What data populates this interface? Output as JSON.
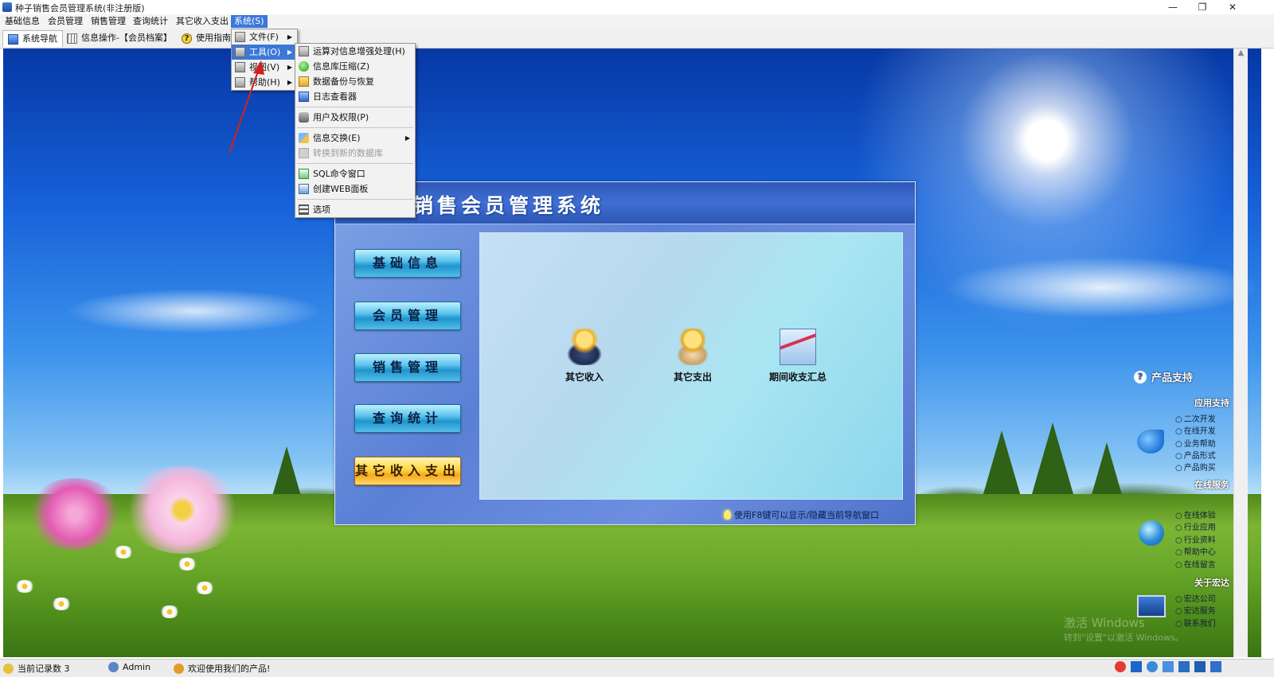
{
  "window": {
    "title": "种子销售会员管理系统(非注册版)",
    "controls": [
      "—",
      "❐",
      "✕"
    ]
  },
  "menubar": [
    {
      "label": "基础信息"
    },
    {
      "label": "会员管理"
    },
    {
      "label": "销售管理"
    },
    {
      "label": "查询统计"
    },
    {
      "label": "其它收入支出"
    },
    {
      "label": "系统(S)"
    }
  ],
  "tabs": [
    {
      "label": "系统导航"
    },
    {
      "label": "信息操作-【会员档案】"
    },
    {
      "label": "使用指南"
    }
  ],
  "system_menu": [
    {
      "label": "文件(F)"
    },
    {
      "label": "工具(O)"
    },
    {
      "label": "视图(V)"
    },
    {
      "label": "帮助(H)"
    }
  ],
  "tools_menu": [
    {
      "label": "运算对信息增强处理(H)"
    },
    {
      "label": "信息库压缩(Z)"
    },
    {
      "label": "数据备份与恢复"
    },
    {
      "label": "日志查看器"
    },
    {
      "label": "用户及权限(P)"
    },
    {
      "label": "信息交换(E)"
    },
    {
      "label": "转换到新的数据库"
    },
    {
      "label": "SQL命令窗口"
    },
    {
      "label": "创建WEB面板"
    },
    {
      "label": "选项"
    }
  ],
  "panel": {
    "title": "销售会员管理系统",
    "nav": [
      {
        "label": "基础信息"
      },
      {
        "label": "会员管理"
      },
      {
        "label": "销售管理"
      },
      {
        "label": "查询统计"
      },
      {
        "label": "其它收入支出"
      }
    ],
    "functions": [
      {
        "label": "其它收入",
        "icon": "money-bag-icon"
      },
      {
        "label": "其它支出",
        "icon": "coin-sack-icon"
      },
      {
        "label": "期间收支汇总",
        "icon": "chart-coins-icon"
      }
    ],
    "hint": "使用F8键可以显示/隐藏当前导航窗口"
  },
  "support": {
    "title": "产品支持",
    "sections": [
      {
        "title": "应用支持",
        "items": [
          "二次开发",
          "在线开发",
          "业务帮助",
          "产品形式",
          "产品购买"
        ]
      },
      {
        "title": "在线服务",
        "items": [
          "在线体验",
          "行业应用",
          "行业资料",
          "帮助中心",
          "在线留言"
        ]
      },
      {
        "title": "关于宏达",
        "items": [
          "宏达公司",
          "宏达服务",
          "联系我们"
        ]
      }
    ]
  },
  "watermark": {
    "line1": "激活 Windows",
    "line2": "转到\"设置\"以激活 Windows。"
  },
  "status": {
    "records": "当前记录数 3",
    "user": "Admin",
    "welcome": "欢迎使用我们的产品!"
  },
  "colors": {
    "accent": "#3c78d8",
    "active_nav": "#ffd542",
    "nav": "#1f95cc"
  }
}
